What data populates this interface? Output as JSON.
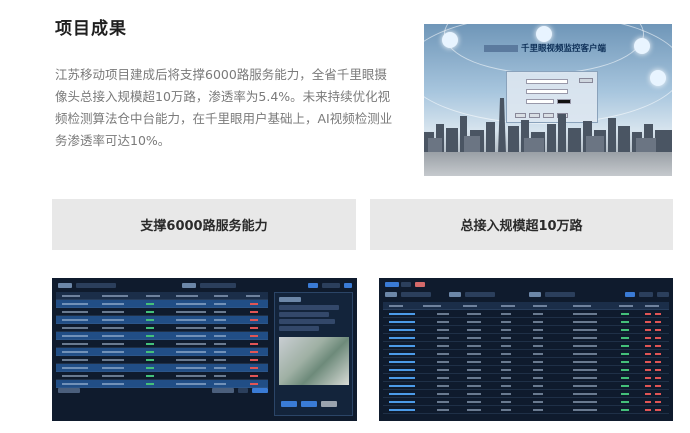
{
  "section": {
    "title": "项目成果",
    "description": "江苏移动项目建成后将支撑6000路服务能力，全省千里眼摄像头总接入规模超10万路，渗透率为5.4%。未来持续优化视频检测算法仓中台能力，在千里眼用户基础上，AI视频检测业务渗透率可达10%。"
  },
  "hero_image": {
    "banner_text": "千里眼视频监控客户端",
    "icon": "login-screen-image"
  },
  "features": [
    {
      "label": "支撑6000路服务能力"
    },
    {
      "label": "总接入规模超10万路"
    }
  ],
  "screenshots": [
    {
      "icon": "dashboard-list-image"
    },
    {
      "icon": "dashboard-table-image"
    }
  ],
  "colors": {
    "feature_bg": "#e8e8e8",
    "dashboard_bg": "#0f1b2d",
    "highlight_row": "#214e86"
  }
}
